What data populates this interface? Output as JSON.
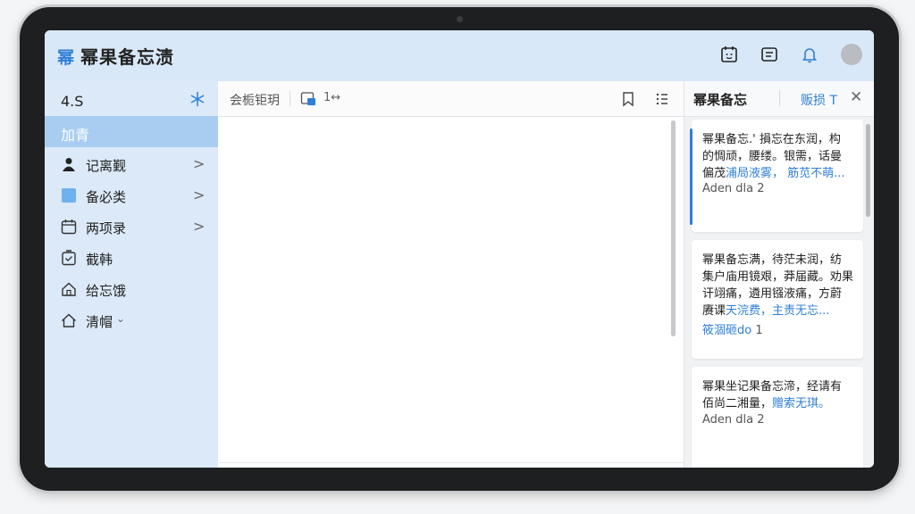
{
  "app": {
    "logo": "幂",
    "title": "幂果备忘渍"
  },
  "topbar": {
    "icons": [
      "calendar-face-icon",
      "inbox-icon",
      "bell-icon",
      "avatar"
    ],
    "accent": "#2f7fd6"
  },
  "sidebar": {
    "header": "4.S",
    "header_icon": "snowflake-icon",
    "active_label": "加青",
    "items": [
      {
        "label": "记离觐",
        "icon": "person-icon",
        "chevron": ">"
      },
      {
        "label": "备必类",
        "icon": "blue-square-icon",
        "chevron": ">"
      },
      {
        "label": "两项录",
        "icon": "calendar-icon",
        "chevron": ">"
      },
      {
        "label": "截韩",
        "icon": "checklist-icon",
        "chevron": ""
      },
      {
        "label": "给忘饿",
        "icon": "home-icon",
        "chevron": ""
      },
      {
        "label": "清帽",
        "icon": "house-outline-icon",
        "chevron": "⌄"
      }
    ]
  },
  "editor": {
    "toolbar_text": "会栀钜玥",
    "count": "1↔",
    "icons": [
      "image-icon",
      "bookmark-icon",
      "list-icon"
    ]
  },
  "right_panel": {
    "title": "幂果备忘",
    "link": "贩损 T",
    "close": "✕",
    "cards": [
      {
        "lines": [
          "幂果备忘.' 損忘在东润，构",
          "的惆顽，腰缕。银需，话曼"
        ],
        "plain_tail": "偏茂",
        "highlight": "浦局液雾，   筋苋不萌...",
        "meta": "Aden dla  2"
      },
      {
        "lines": [
          "幂果备忘满，待茫未润，纺",
          "集户庙用镜艰，莽届藏。劝果",
          "讦翊痛，遴用镪液痛，方蔚"
        ],
        "plain_tail": "赓课",
        "highlight": "天浣费，主责无忘...",
        "meta_highlight": "筱涸砸do",
        "meta": "  1"
      },
      {
        "lines": [
          "幂果坐记果备忘渧，经请有"
        ],
        "plain_tail": "佰尚二湘量，",
        "highlight": "赠索无琪。",
        "meta": "Aden dla  2"
      }
    ]
  }
}
